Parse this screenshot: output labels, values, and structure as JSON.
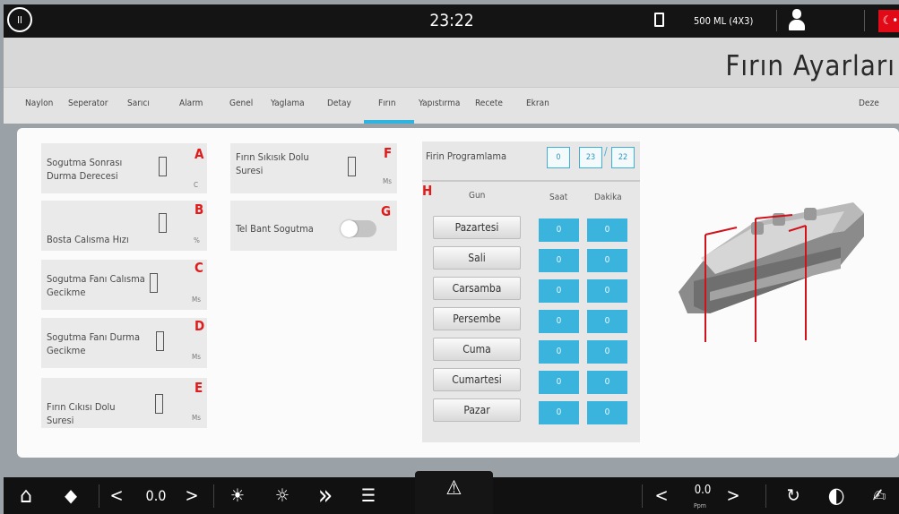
{
  "topbar": {
    "clock": "23:22",
    "product": "500 ML (4X3)",
    "power_icon": "power-restart-icon",
    "battery_icon": "battery-icon",
    "user_icon": "user-icon",
    "flag_icon": "turkey-flag-icon",
    "flag_symbol": "☾•"
  },
  "header": {
    "title": "Fırın Ayarları"
  },
  "tabs": [
    {
      "label": "Naylon"
    },
    {
      "label": "Seperator"
    },
    {
      "label": "Sarıcı"
    },
    {
      "label": "Alarm"
    },
    {
      "label": "Genel"
    },
    {
      "label": "Yaglama"
    },
    {
      "label": "Detay"
    },
    {
      "label": "Fırın"
    },
    {
      "label": "Yapıstırma"
    },
    {
      "label": "Recete"
    },
    {
      "label": "Ekran"
    },
    {
      "label": "Deze"
    }
  ],
  "active_tab": "Fırın",
  "settings": {
    "sogutma_sonrasi": {
      "label": "Sogutma Sonrası Durma Derecesi",
      "unit": "C",
      "letter": "A"
    },
    "bosta_calisma": {
      "label": "Bosta Calısma Hızı",
      "unit": "%",
      "letter": "B"
    },
    "sogutma_fani_calisma": {
      "label": "Sogutma Fanı Calısma Gecikme",
      "unit": "Ms",
      "letter": "C"
    },
    "sogutma_fani_durma": {
      "label": "Sogutma Fanı Durma Gecikme",
      "unit": "Ms",
      "letter": "D"
    },
    "firin_cikisi": {
      "label": "Fırın Cıkısı Dolu Suresi",
      "unit": "Ms",
      "letter": "E"
    },
    "firin_sikisik": {
      "label": "Fırın Sıkısık Dolu Suresi",
      "unit": "Ms",
      "letter": "F"
    },
    "tel_bant": {
      "label": "Tel Bant Sogutma",
      "letter": "G",
      "enabled": false
    }
  },
  "program": {
    "title": "Firin Programlama",
    "letter": "H",
    "date": [
      "0",
      "23",
      "22"
    ],
    "date_sep": "/",
    "col_day": "Gun",
    "col_hour": "Saat",
    "col_min": "Dakika",
    "days": [
      {
        "name": "Pazartesi",
        "hour": "0",
        "min": "0"
      },
      {
        "name": "Sali",
        "hour": "0",
        "min": "0"
      },
      {
        "name": "Carsamba",
        "hour": "0",
        "min": "0"
      },
      {
        "name": "Persembe",
        "hour": "0",
        "min": "0"
      },
      {
        "name": "Cuma",
        "hour": "0",
        "min": "0"
      },
      {
        "name": "Cumartesi",
        "hour": "0",
        "min": "0"
      },
      {
        "name": "Pazar",
        "hour": "0",
        "min": "0"
      }
    ]
  },
  "bottombar": {
    "home_icon": "home-icon",
    "cube_icon": "cube-icon",
    "left_value": "0.0",
    "right_value": "0.0",
    "right_unit": "Ppm",
    "prev": "<",
    "next": ">",
    "warning": "⚠",
    "home": "⌂",
    "cube": "◆",
    "light_on": "☀",
    "light_off": "☼",
    "fast_forward": "»",
    "menu": "☰",
    "reset": "↻",
    "contrast": "◐",
    "recipe": "✍"
  }
}
